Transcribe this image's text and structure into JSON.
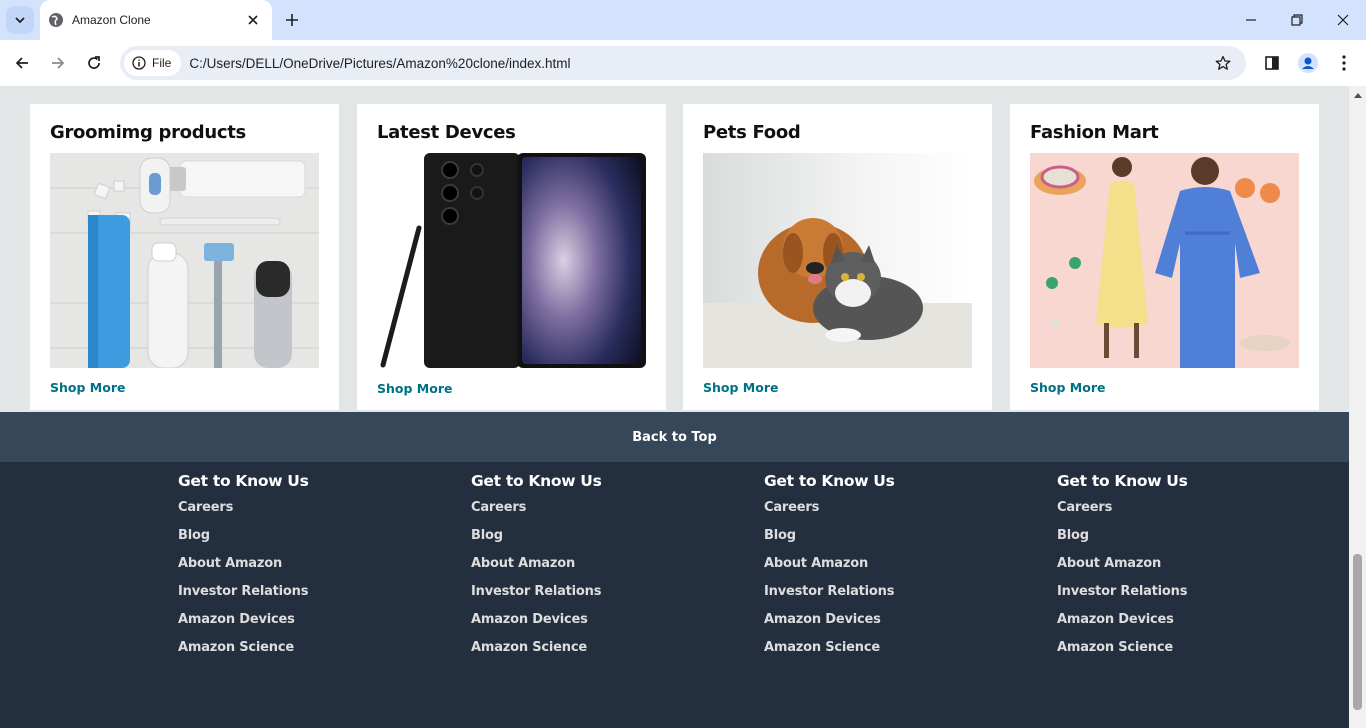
{
  "browser": {
    "tab_title": "Amazon Clone",
    "site_chip": "File",
    "url": "C:/Users/DELL/OneDrive/Pictures/Amazon%20clone/index.html"
  },
  "cards": [
    {
      "title": "Groomimg products",
      "link": "Shop More",
      "image": "grooming-products-photo"
    },
    {
      "title": "Latest Devces",
      "link": "Shop More",
      "image": "smartphone-photo"
    },
    {
      "title": "Pets Food",
      "link": "Shop More",
      "image": "dog-and-cat-photo"
    },
    {
      "title": "Fashion Mart",
      "link": "Shop More",
      "image": "fashion-models-photo"
    }
  ],
  "back_to_top": "Back to Top",
  "footer": {
    "columns": [
      {
        "heading": "Get to Know Us",
        "links": [
          "Careers",
          "Blog",
          "About Amazon",
          "Investor Relations",
          "Amazon Devices",
          "Amazon Science"
        ]
      },
      {
        "heading": "Get to Know Us",
        "links": [
          "Careers",
          "Blog",
          "About Amazon",
          "Investor Relations",
          "Amazon Devices",
          "Amazon Science"
        ]
      },
      {
        "heading": "Get to Know Us",
        "links": [
          "Careers",
          "Blog",
          "About Amazon",
          "Investor Relations",
          "Amazon Devices",
          "Amazon Science"
        ]
      },
      {
        "heading": "Get to Know Us",
        "links": [
          "Careers",
          "Blog",
          "About Amazon",
          "Investor Relations",
          "Amazon Devices",
          "Amazon Science"
        ]
      }
    ]
  },
  "colors": {
    "tabbar": "#d3e3fd",
    "link_teal": "#007185",
    "back_to_top_bg": "#37475a",
    "footer_bg": "#232f3e",
    "page_bg": "#e3e6e6"
  }
}
